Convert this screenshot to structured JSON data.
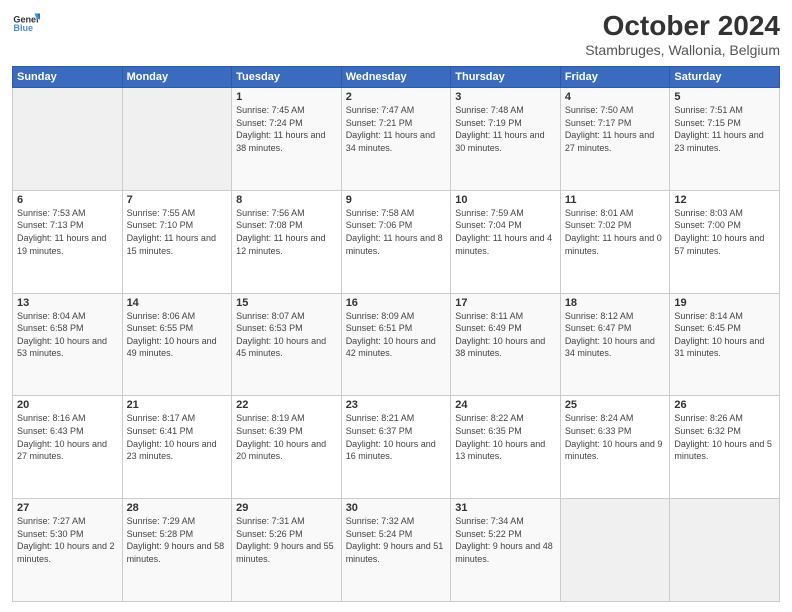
{
  "logo": {
    "line1": "General",
    "line2": "Blue"
  },
  "title": "October 2024",
  "subtitle": "Stambruges, Wallonia, Belgium",
  "headers": [
    "Sunday",
    "Monday",
    "Tuesday",
    "Wednesday",
    "Thursday",
    "Friday",
    "Saturday"
  ],
  "weeks": [
    [
      {
        "day": "",
        "info": ""
      },
      {
        "day": "",
        "info": ""
      },
      {
        "day": "1",
        "sunrise": "7:45 AM",
        "sunset": "7:24 PM",
        "daylight": "11 hours and 38 minutes."
      },
      {
        "day": "2",
        "sunrise": "7:47 AM",
        "sunset": "7:21 PM",
        "daylight": "11 hours and 34 minutes."
      },
      {
        "day": "3",
        "sunrise": "7:48 AM",
        "sunset": "7:19 PM",
        "daylight": "11 hours and 30 minutes."
      },
      {
        "day": "4",
        "sunrise": "7:50 AM",
        "sunset": "7:17 PM",
        "daylight": "11 hours and 27 minutes."
      },
      {
        "day": "5",
        "sunrise": "7:51 AM",
        "sunset": "7:15 PM",
        "daylight": "11 hours and 23 minutes."
      }
    ],
    [
      {
        "day": "6",
        "sunrise": "7:53 AM",
        "sunset": "7:13 PM",
        "daylight": "11 hours and 19 minutes."
      },
      {
        "day": "7",
        "sunrise": "7:55 AM",
        "sunset": "7:10 PM",
        "daylight": "11 hours and 15 minutes."
      },
      {
        "day": "8",
        "sunrise": "7:56 AM",
        "sunset": "7:08 PM",
        "daylight": "11 hours and 12 minutes."
      },
      {
        "day": "9",
        "sunrise": "7:58 AM",
        "sunset": "7:06 PM",
        "daylight": "11 hours and 8 minutes."
      },
      {
        "day": "10",
        "sunrise": "7:59 AM",
        "sunset": "7:04 PM",
        "daylight": "11 hours and 4 minutes."
      },
      {
        "day": "11",
        "sunrise": "8:01 AM",
        "sunset": "7:02 PM",
        "daylight": "11 hours and 0 minutes."
      },
      {
        "day": "12",
        "sunrise": "8:03 AM",
        "sunset": "7:00 PM",
        "daylight": "10 hours and 57 minutes."
      }
    ],
    [
      {
        "day": "13",
        "sunrise": "8:04 AM",
        "sunset": "6:58 PM",
        "daylight": "10 hours and 53 minutes."
      },
      {
        "day": "14",
        "sunrise": "8:06 AM",
        "sunset": "6:55 PM",
        "daylight": "10 hours and 49 minutes."
      },
      {
        "day": "15",
        "sunrise": "8:07 AM",
        "sunset": "6:53 PM",
        "daylight": "10 hours and 45 minutes."
      },
      {
        "day": "16",
        "sunrise": "8:09 AM",
        "sunset": "6:51 PM",
        "daylight": "10 hours and 42 minutes."
      },
      {
        "day": "17",
        "sunrise": "8:11 AM",
        "sunset": "6:49 PM",
        "daylight": "10 hours and 38 minutes."
      },
      {
        "day": "18",
        "sunrise": "8:12 AM",
        "sunset": "6:47 PM",
        "daylight": "10 hours and 34 minutes."
      },
      {
        "day": "19",
        "sunrise": "8:14 AM",
        "sunset": "6:45 PM",
        "daylight": "10 hours and 31 minutes."
      }
    ],
    [
      {
        "day": "20",
        "sunrise": "8:16 AM",
        "sunset": "6:43 PM",
        "daylight": "10 hours and 27 minutes."
      },
      {
        "day": "21",
        "sunrise": "8:17 AM",
        "sunset": "6:41 PM",
        "daylight": "10 hours and 23 minutes."
      },
      {
        "day": "22",
        "sunrise": "8:19 AM",
        "sunset": "6:39 PM",
        "daylight": "10 hours and 20 minutes."
      },
      {
        "day": "23",
        "sunrise": "8:21 AM",
        "sunset": "6:37 PM",
        "daylight": "10 hours and 16 minutes."
      },
      {
        "day": "24",
        "sunrise": "8:22 AM",
        "sunset": "6:35 PM",
        "daylight": "10 hours and 13 minutes."
      },
      {
        "day": "25",
        "sunrise": "8:24 AM",
        "sunset": "6:33 PM",
        "daylight": "10 hours and 9 minutes."
      },
      {
        "day": "26",
        "sunrise": "8:26 AM",
        "sunset": "6:32 PM",
        "daylight": "10 hours and 5 minutes."
      }
    ],
    [
      {
        "day": "27",
        "sunrise": "7:27 AM",
        "sunset": "5:30 PM",
        "daylight": "10 hours and 2 minutes."
      },
      {
        "day": "28",
        "sunrise": "7:29 AM",
        "sunset": "5:28 PM",
        "daylight": "9 hours and 58 minutes."
      },
      {
        "day": "29",
        "sunrise": "7:31 AM",
        "sunset": "5:26 PM",
        "daylight": "9 hours and 55 minutes."
      },
      {
        "day": "30",
        "sunrise": "7:32 AM",
        "sunset": "5:24 PM",
        "daylight": "9 hours and 51 minutes."
      },
      {
        "day": "31",
        "sunrise": "7:34 AM",
        "sunset": "5:22 PM",
        "daylight": "9 hours and 48 minutes."
      },
      {
        "day": "",
        "info": ""
      },
      {
        "day": "",
        "info": ""
      }
    ]
  ],
  "labels": {
    "sunrise": "Sunrise:",
    "sunset": "Sunset:",
    "daylight": "Daylight:"
  }
}
